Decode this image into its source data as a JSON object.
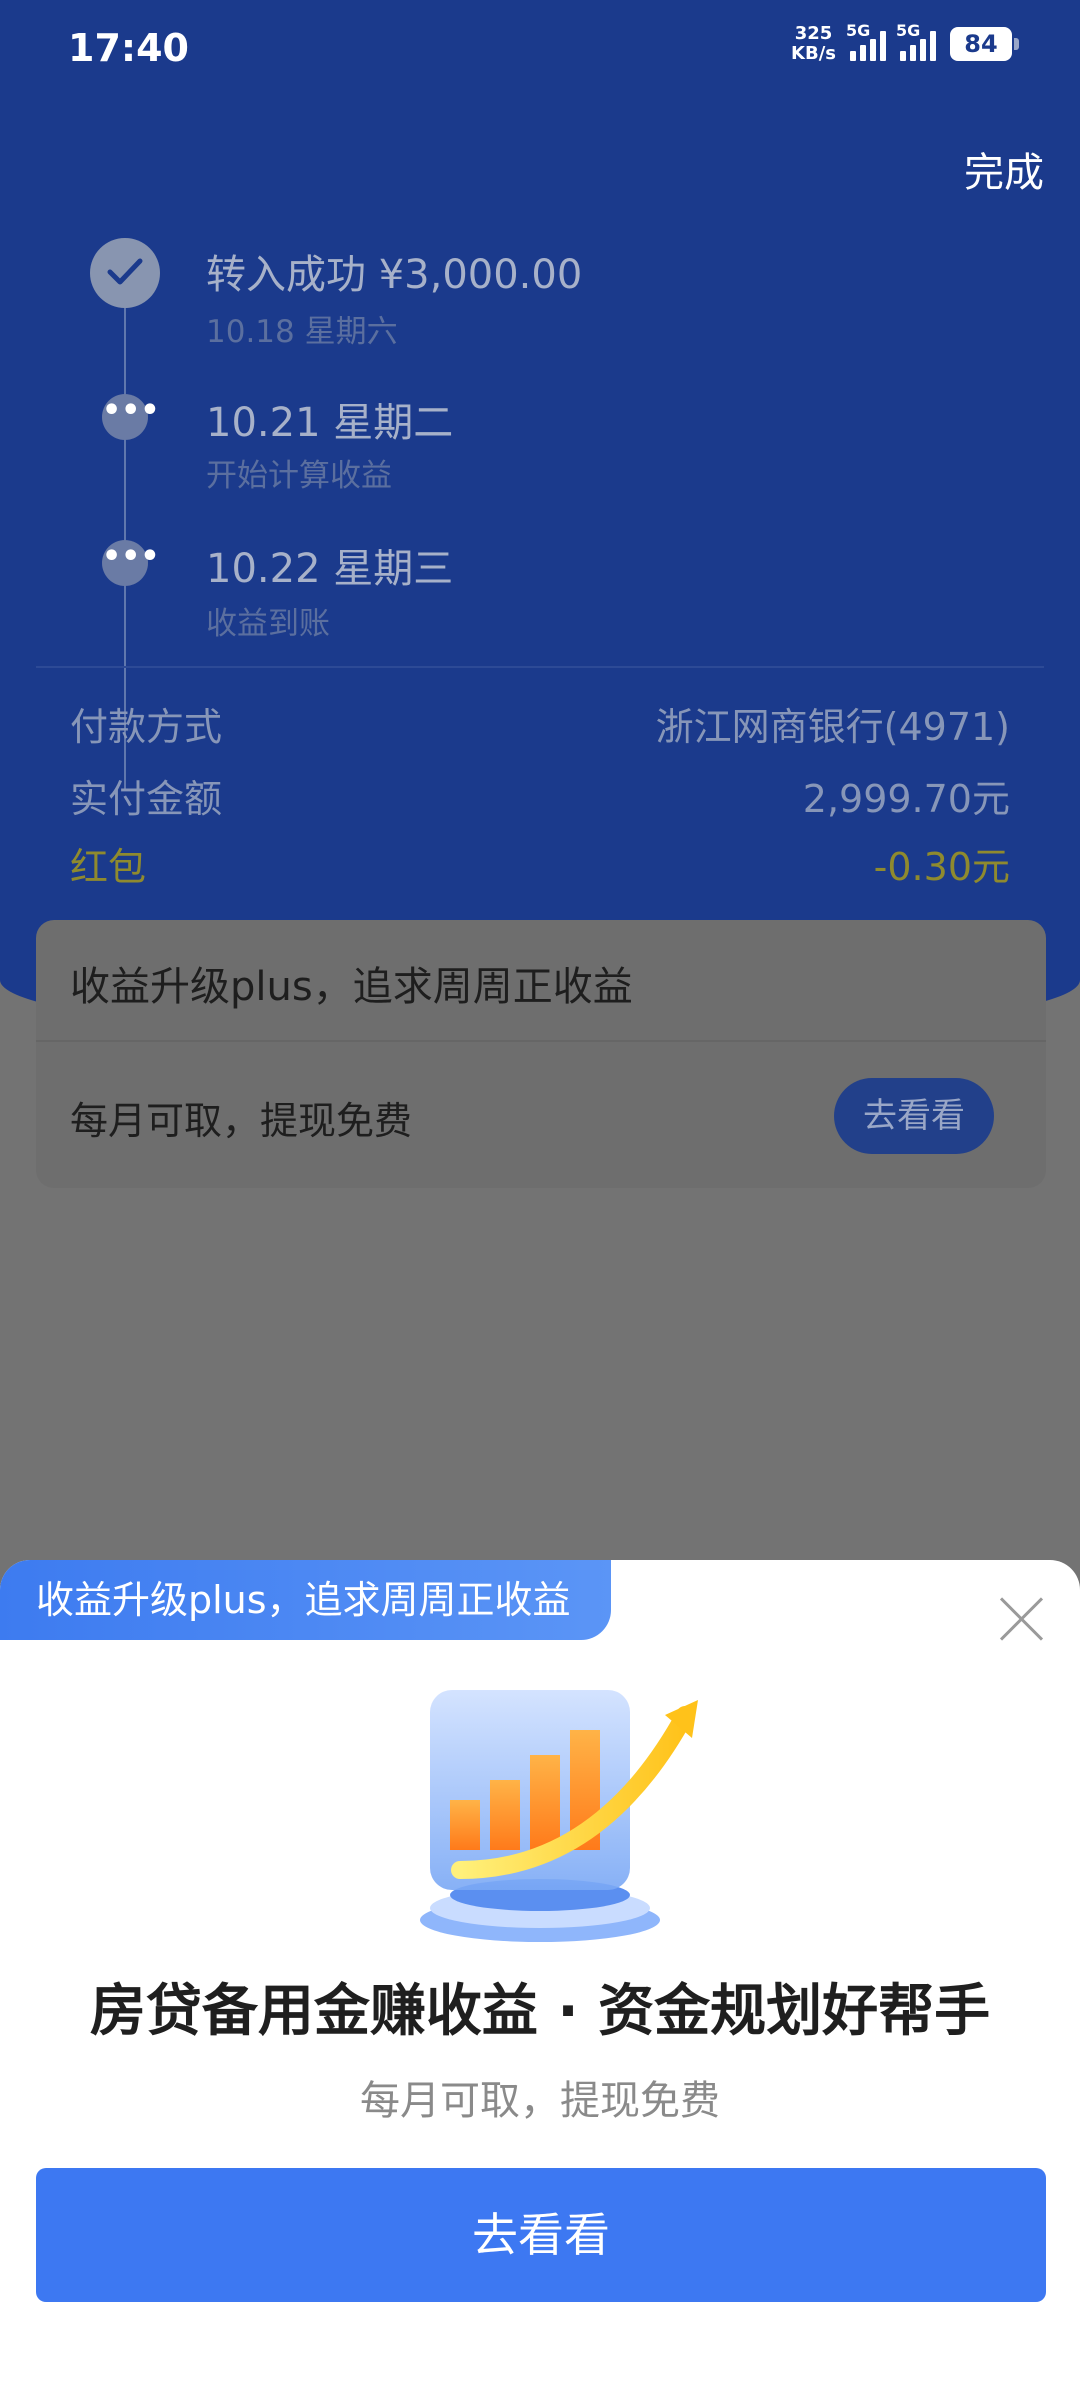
{
  "status_bar": {
    "time": "17:40",
    "net_speed_top": "325",
    "net_speed_bottom": "KB/s",
    "signal1_label": "5G",
    "signal2_label": "5G",
    "battery": "84"
  },
  "header": {
    "done_label": "完成"
  },
  "timeline": {
    "step1": {
      "title": "转入成功 ¥3,000.00",
      "subtitle": "10.18 星期六"
    },
    "step2": {
      "title": "10.21 星期二",
      "subtitle": "开始计算收益"
    },
    "step3": {
      "title": "10.22 星期三",
      "subtitle": "收益到账"
    }
  },
  "details": {
    "payment_method": {
      "label": "付款方式",
      "value": "浙江网商银行(4971)"
    },
    "paid_amount": {
      "label": "实付金额",
      "value": "2,999.70元"
    },
    "red_packet": {
      "label": "红包",
      "value": "-0.30元"
    }
  },
  "promo_card": {
    "title": "收益升级plus，追求周周正收益",
    "subtitle": "每月可取，提现免费",
    "button": "去看看"
  },
  "sheet": {
    "tag": "收益升级plus，追求周周正收益",
    "title": "房贷备用金赚收益 · 资金规划好帮手",
    "subtitle": "每月可取，提现免费",
    "cta": "去看看",
    "illustration_icon": "growth-chart-icon"
  },
  "colors": {
    "header_blue": "#1b3a8c",
    "cta_blue": "#3d78f2",
    "overlay_gray": "#737373"
  }
}
